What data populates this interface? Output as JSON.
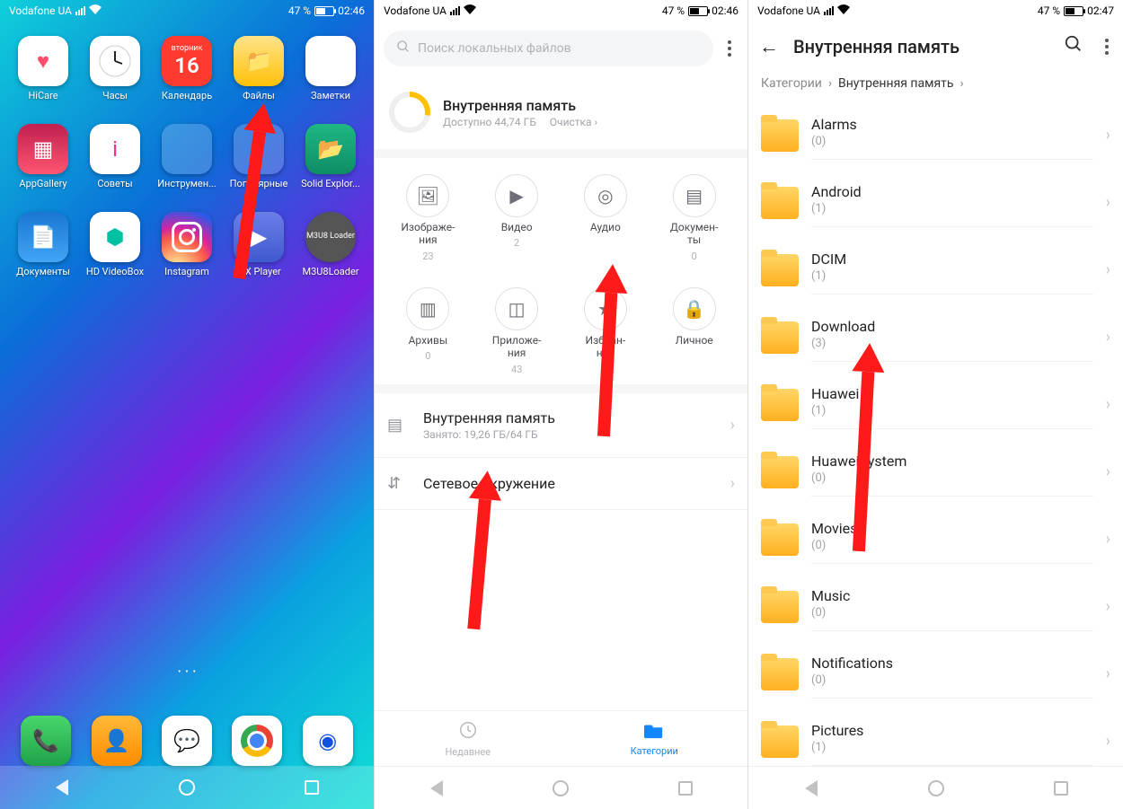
{
  "status": {
    "carrier": "Vodafone UA",
    "battery_pct": "47 %",
    "time1": "02:46",
    "time2": "02:47"
  },
  "home": {
    "apps": [
      {
        "label": "HiCare",
        "icon": "♥",
        "cls": "bg-wh"
      },
      {
        "label": "Часы",
        "icon": "clock",
        "cls": "bg-clock"
      },
      {
        "label": "Календарь",
        "icon": "cal",
        "cls": "bg-cal",
        "day": "вторник",
        "date": "16"
      },
      {
        "label": "Файлы",
        "icon": "📁",
        "cls": "bg-files"
      },
      {
        "label": "Заметки",
        "icon": "≡",
        "cls": "bg-notes"
      },
      {
        "label": "AppGallery",
        "icon": "▦",
        "cls": "bg-appg"
      },
      {
        "label": "Советы",
        "icon": "i",
        "cls": "bg-tips"
      },
      {
        "label": "Инструмен...",
        "icon": "grid",
        "cls": "bg-tools"
      },
      {
        "label": "Популярные",
        "icon": "grid",
        "cls": "bg-pop"
      },
      {
        "label": "Solid Explor...",
        "icon": "📂",
        "cls": "bg-se"
      },
      {
        "label": "Документы",
        "icon": "📄",
        "cls": "bg-docs"
      },
      {
        "label": "HD VideoBox",
        "icon": "⬢",
        "cls": "bg-hdv"
      },
      {
        "label": "Instagram",
        "icon": "ig",
        "cls": "bg-ig"
      },
      {
        "label": "MX Player",
        "icon": "▶",
        "cls": "bg-mx"
      },
      {
        "label": "M3U8Loader",
        "icon": "M3U8 Loader",
        "cls": "bg-m3"
      }
    ],
    "dock": [
      {
        "icon": "📞",
        "cls": "bg-phone",
        "name": "phone"
      },
      {
        "icon": "👤",
        "cls": "bg-cont",
        "name": "contacts"
      },
      {
        "icon": "💬",
        "cls": "bg-msg",
        "name": "messages"
      },
      {
        "icon": "chr",
        "cls": "bg-chr",
        "name": "chrome"
      },
      {
        "icon": "◉",
        "cls": "bg-cam",
        "name": "camera"
      }
    ]
  },
  "files": {
    "search_placeholder": "Поиск локальных файлов",
    "storage_title": "Внутренняя память",
    "storage_sub": "Доступно 44,74 ГБ",
    "storage_clean": "Очистка",
    "categories": [
      {
        "label": "Изображе-\nния",
        "count": "23",
        "icon": "🖼"
      },
      {
        "label": "Видео",
        "count": "2",
        "icon": "▶"
      },
      {
        "label": "Аудио",
        "count": "",
        "icon": "◎"
      },
      {
        "label": "Докумен-\nты",
        "count": "0",
        "icon": "▤"
      },
      {
        "label": "Архивы",
        "count": "0",
        "icon": "▥"
      },
      {
        "label": "Приложе-\nния",
        "count": "43",
        "icon": "◫"
      },
      {
        "label": "Избран-\nное",
        "count": "0",
        "icon": "★"
      },
      {
        "label": "Личное",
        "count": "",
        "icon": "🔒"
      }
    ],
    "rows": [
      {
        "title": "Внутренняя память",
        "sub": "Занято: 19,26 ГБ/64 ГБ",
        "icon": "▤"
      },
      {
        "title": "Сетевое окружение",
        "sub": "",
        "icon": "⇵"
      }
    ],
    "tabs": {
      "recent": "Недавнее",
      "categories": "Категории"
    }
  },
  "browse": {
    "title": "Внутренняя память",
    "crumb_root": "Категории",
    "crumb_cur": "Внутренняя память",
    "folders": [
      {
        "name": "Alarms",
        "count": "(0)"
      },
      {
        "name": "Android",
        "count": "(1)"
      },
      {
        "name": "DCIM",
        "count": "(1)"
      },
      {
        "name": "Download",
        "count": "(3)"
      },
      {
        "name": "Huawei",
        "count": "(1)"
      },
      {
        "name": "HuaweiSystem",
        "count": "(0)"
      },
      {
        "name": "Movies",
        "count": "(0)"
      },
      {
        "name": "Music",
        "count": "(0)"
      },
      {
        "name": "Notifications",
        "count": "(0)"
      },
      {
        "name": "Pictures",
        "count": "(1)"
      }
    ]
  }
}
